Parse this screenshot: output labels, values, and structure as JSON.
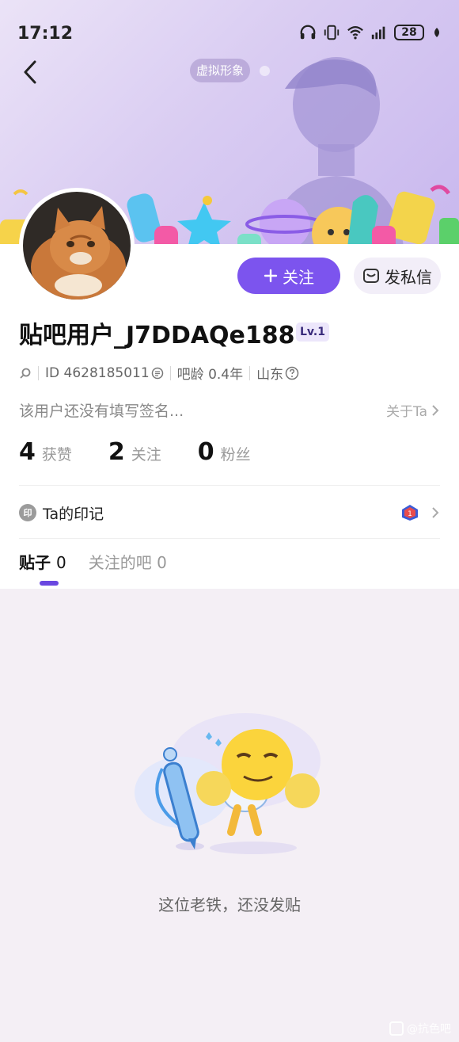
{
  "status_bar": {
    "time": "17:12",
    "battery": "28"
  },
  "header": {
    "avatar_chip_label": "虚拟形象"
  },
  "profile": {
    "follow_label": "关注",
    "message_label": "发私信",
    "username": "贴吧用户_J7DDAQe188",
    "level": "Lv.1",
    "id_text": "ID 4628185011",
    "age_text": "吧龄 0.4年",
    "location": "山东",
    "signature": "该用户还没有填写签名...",
    "about_label": "关于Ta"
  },
  "stats": [
    {
      "num": "4",
      "label": "获赞"
    },
    {
      "num": "2",
      "label": "关注"
    },
    {
      "num": "0",
      "label": "粉丝"
    }
  ],
  "mark": {
    "icon_text": "印",
    "label": "Ta的印记"
  },
  "tabs": [
    {
      "label": "贴子",
      "count": "0"
    },
    {
      "label": "关注的吧",
      "count": "0"
    }
  ],
  "empty_state": {
    "text": "这位老铁，还没发贴"
  },
  "watermark": {
    "text": "@抗色吧"
  },
  "colors": {
    "accent": "#7c54ee",
    "banner": "#d9ccf2",
    "background": "#f4eff5"
  }
}
